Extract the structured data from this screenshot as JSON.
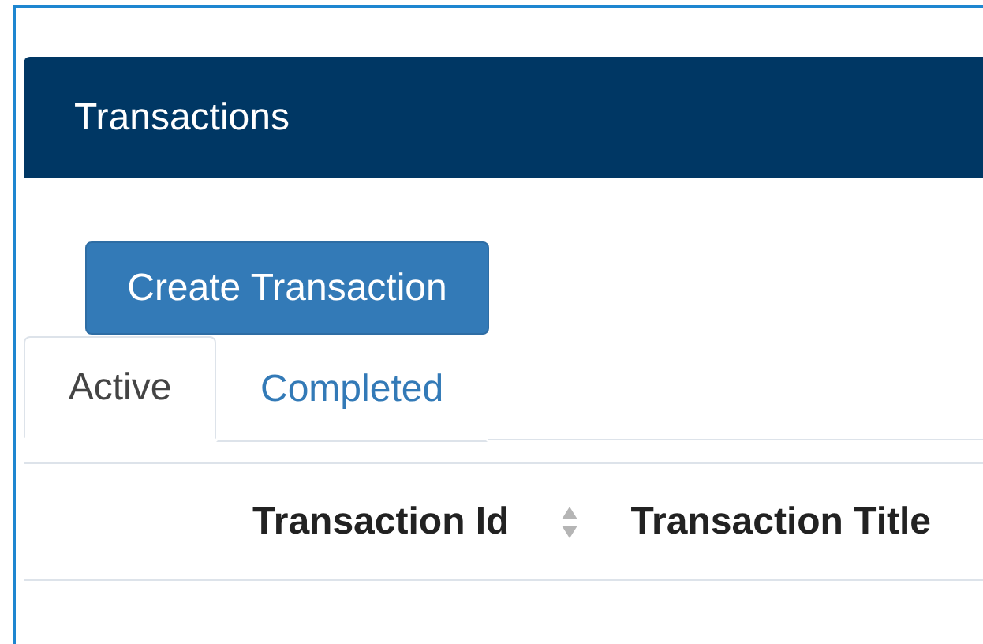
{
  "panel": {
    "title": "Transactions"
  },
  "create_button": {
    "label": "Create Transaction"
  },
  "tabs": [
    {
      "label": "Active",
      "selected": true
    },
    {
      "label": "Completed",
      "selected": false
    }
  ],
  "table": {
    "columns": [
      {
        "label": "Transaction Id",
        "sortable": true
      },
      {
        "label": "Transaction Title",
        "sortable": false
      }
    ]
  }
}
